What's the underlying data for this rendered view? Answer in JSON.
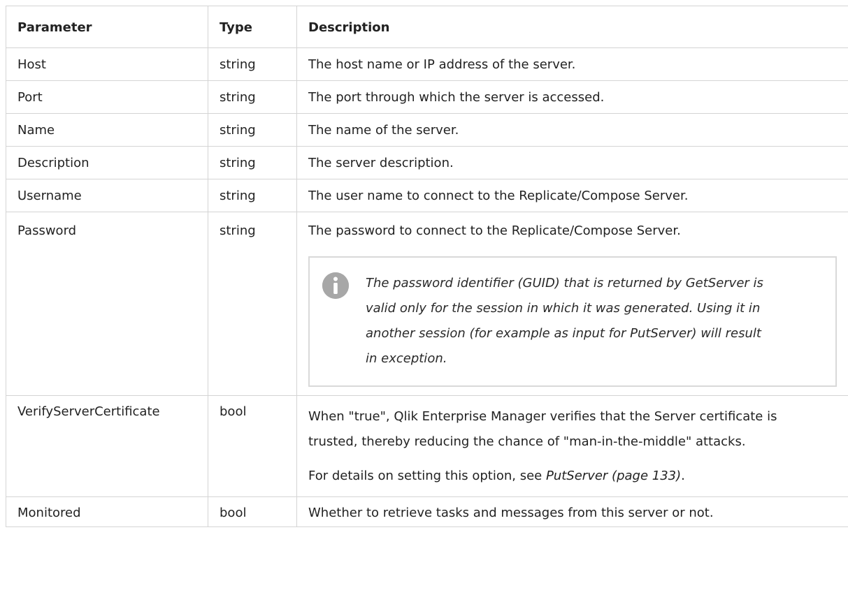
{
  "headers": {
    "parameter": "Parameter",
    "type": "Type",
    "description": "Description"
  },
  "rows": [
    {
      "parameter": "Host",
      "type": "string",
      "description": "The host name or IP address of the server."
    },
    {
      "parameter": "Port",
      "type": "string",
      "description": "The port through which the server is accessed."
    },
    {
      "parameter": "Name",
      "type": "string",
      "description": "The name of the server."
    },
    {
      "parameter": "Description",
      "type": "string",
      "description": "The server description."
    },
    {
      "parameter": "Username",
      "type": "string",
      "description": "The user name to connect to the Replicate/Compose Server."
    },
    {
      "parameter": "Password",
      "type": "string",
      "description": "The password to connect to the Replicate/Compose Server.",
      "note": "The password identifier (GUID) that is returned by GetServer is valid only for the session in which it was generated. Using it in another session (for example as input for PutServer) will result in exception."
    },
    {
      "parameter": "VerifyServerCertificate",
      "type": "bool",
      "description": "When \"true\", Qlik Enterprise Manager verifies that the Server certificate is trusted, thereby reducing the chance of \"man-in-the-middle\" attacks.",
      "details_prefix": "For details on setting this option, see ",
      "details_link": "PutServer (page 133)",
      "details_suffix": "."
    },
    {
      "parameter": "Monitored",
      "type": "bool",
      "description": "Whether to retrieve tasks and messages from this server or not."
    }
  ],
  "note_icon": "info-icon",
  "colors": {
    "border": "#d4d4d4",
    "icon": "#a7a7a7"
  }
}
